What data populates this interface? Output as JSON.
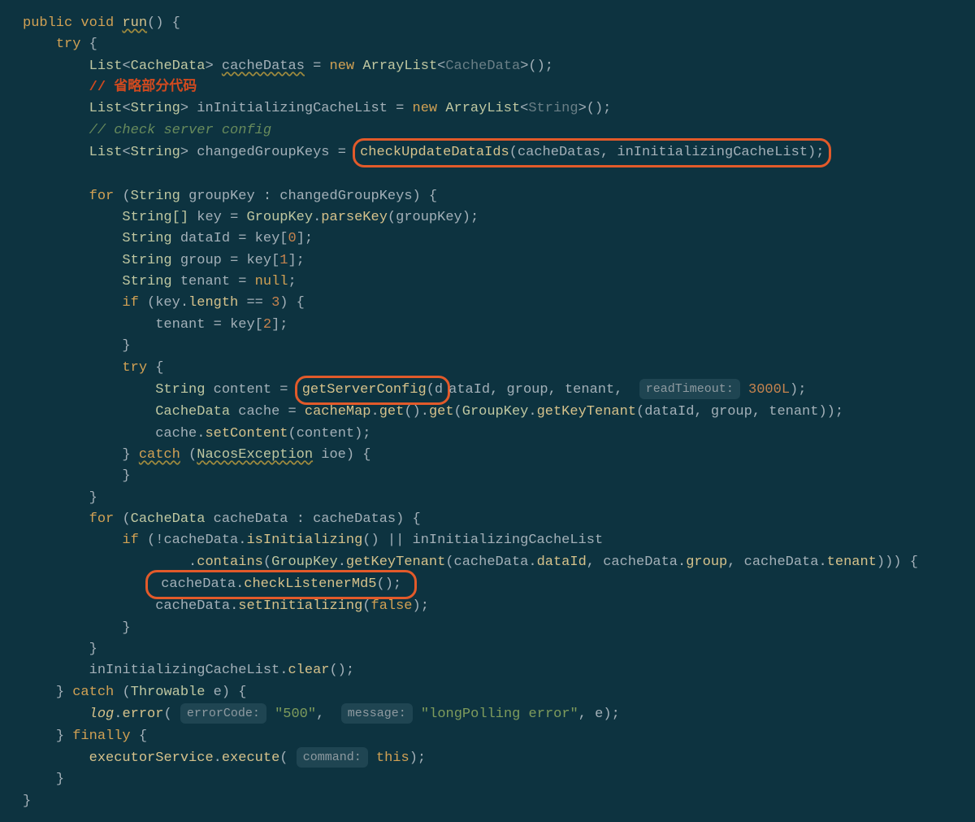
{
  "t": {
    "kw_public": "public",
    "kw_void": "void",
    "fn_run": "run",
    "kw_try": "try",
    "type_List": "List",
    "type_CacheData": "CacheData",
    "id_cacheDatas": "cacheDatas",
    "kw_new": "new",
    "type_ArrayList": "ArrayList",
    "cmt_omit": "// 省略部分代码",
    "type_String": "String",
    "id_inInitCacheList": "inInitializingCacheList",
    "cmt_check": "// check server config",
    "id_changedGroupKeys": "changedGroupKeys",
    "fn_checkUpdateDataIds": "checkUpdateDataIds",
    "kw_for": "for",
    "id_groupKey": "groupKey",
    "type_StringArr": "String[]",
    "id_key": "key",
    "type_GroupKey": "GroupKey",
    "fn_parseKey": "parseKey",
    "id_dataId": "dataId",
    "num0": "0",
    "id_group": "group",
    "num1": "1",
    "id_tenant": "tenant",
    "kw_null": "null",
    "kw_if": "if",
    "field_length": "length",
    "op_eqeq": "==",
    "num3": "3",
    "num2": "2",
    "id_content": "content",
    "fn_getServerConfig": "getServerConfig",
    "hint_readTimeout": "readTimeout:",
    "num3000L": "3000L",
    "id_cache": "cache",
    "id_cacheMap": "cacheMap",
    "fn_get": "get",
    "fn_getKeyTenant": "getKeyTenant",
    "fn_setContent": "setContent",
    "kw_catch": "catch",
    "type_NacosException": "NacosException",
    "id_ioe": "ioe",
    "id_cacheData": "cacheData",
    "fn_isInitializing": "isInitializing",
    "op_or": "||",
    "fn_contains": "contains",
    "field_dataId": "dataId",
    "field_group": "group",
    "field_tenant": "tenant",
    "fn_checkListenerMd5": "checkListenerMd5",
    "fn_setInitializing": "setInitializing",
    "kw_false": "false",
    "fn_clear": "clear",
    "type_Throwable": "Throwable",
    "id_e": "e",
    "id_log": "log",
    "fn_error": "error",
    "hint_errorCode": "errorCode:",
    "str_500": "\"500\"",
    "hint_message": "message:",
    "str_longPoll": "\"longPolling error\"",
    "kw_finally": "finally",
    "id_executorService": "executorService",
    "fn_execute": "execute",
    "hint_command": "command:",
    "kw_this": "this"
  }
}
